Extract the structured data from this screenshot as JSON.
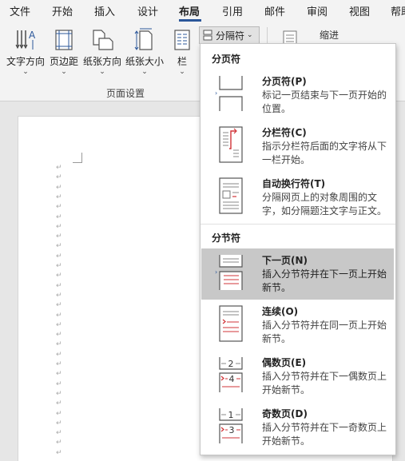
{
  "menu": {
    "tabs": [
      {
        "label": "文件"
      },
      {
        "label": "开始"
      },
      {
        "label": "插入"
      },
      {
        "label": "设计"
      },
      {
        "label": "布局"
      },
      {
        "label": "引用"
      },
      {
        "label": "邮件"
      },
      {
        "label": "审阅"
      },
      {
        "label": "视图"
      },
      {
        "label": "帮助"
      }
    ],
    "active": "布局"
  },
  "ribbon": {
    "buttons": [
      {
        "label": "文字方向",
        "caret": "⌄"
      },
      {
        "label": "页边距",
        "caret": "⌄"
      },
      {
        "label": "纸张方向",
        "caret": "⌄"
      },
      {
        "label": "纸张大小",
        "caret": "⌄"
      },
      {
        "label": "栏",
        "caret": "⌄"
      }
    ],
    "group_label": "页面设置",
    "breaks_button": {
      "label": "分隔符",
      "caret": "⌄"
    },
    "indent_label": "缩进"
  },
  "dropdown": {
    "page_breaks_heading": "分页符",
    "page_breaks": [
      {
        "title": "分页符(P)",
        "desc": "标记一页结束与下一页开始的位置。",
        "icon": "page-break-icon"
      },
      {
        "title": "分栏符(C)",
        "desc": "指示分栏符后面的文字将从下一栏开始。",
        "icon": "column-break-icon"
      },
      {
        "title": "自动换行符(T)",
        "desc": "分隔网页上的对象周围的文字，如分隔题注文字与正文。",
        "icon": "text-wrapping-icon"
      }
    ],
    "section_breaks_heading": "分节符",
    "section_breaks": [
      {
        "title": "下一页(N)",
        "desc": "插入分节符并在下一页上开始新节。",
        "icon": "next-page-icon"
      },
      {
        "title": "连续(O)",
        "desc": "插入分节符并在同一页上开始新节。",
        "icon": "continuous-icon"
      },
      {
        "title": "偶数页(E)",
        "desc": "插入分节符并在下一偶数页上开始新节。",
        "icon": "even-page-icon"
      },
      {
        "title": "奇数页(D)",
        "desc": "插入分节符并在下一奇数页上开始新节。",
        "icon": "odd-page-icon"
      }
    ],
    "icon_numbers": {
      "even_a": "2",
      "even_b": "4",
      "odd_a": "1",
      "odd_b": "3"
    }
  },
  "document": {
    "paragraph_mark": "↵"
  },
  "colors": {
    "accent": "#2b579a",
    "break_red": "#d13438",
    "selected_bg": "#c8c8c8"
  }
}
